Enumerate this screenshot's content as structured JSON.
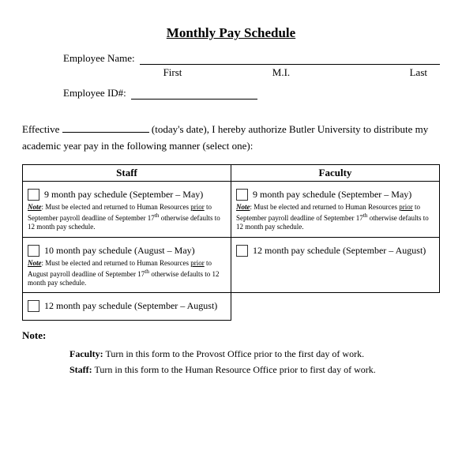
{
  "title": "Monthly Pay Schedule",
  "fields": {
    "name_label": "Employee  Name:",
    "first": "First",
    "mi": "M.I.",
    "last": "Last",
    "id_label": "Employee ID#:"
  },
  "paragraph": {
    "prefix": "Effective",
    "after_date": "(today's date), I hereby authorize Butler University to distribute my academic year pay in the following manner (select one):"
  },
  "table": {
    "headers": {
      "staff": "Staff",
      "faculty": "Faculty"
    },
    "staff": {
      "opt1": {
        "label": "9 month pay schedule (September – May)",
        "note_prefix": "Note",
        "note_body": ": Must be elected and returned to Human Resources ",
        "note_u": "prior",
        "note_tail": " to September payroll deadline of September 17",
        "note_end": " otherwise defaults to 12 month pay schedule."
      },
      "opt2": {
        "label": "10 month pay schedule (August – May)",
        "note_prefix": "Note",
        "note_body": ": Must be elected and returned to Human Resources ",
        "note_u": "prior",
        "note_tail": " to August payroll deadline of September 17",
        "note_end": " otherwise defaults to 12 month pay schedule."
      },
      "opt3": {
        "label": "12 month pay schedule (September – August)"
      }
    },
    "faculty": {
      "opt1": {
        "label": "9 month pay schedule (September – May)",
        "note_prefix": "Note",
        "note_body": ": Must be elected and returned to Human Resources ",
        "note_u": "prior",
        "note_tail": " to September payroll deadline of September 17",
        "note_end": " otherwise defaults to 12 month pay schedule."
      },
      "opt2": {
        "label": "12 month pay schedule (September – August)"
      }
    }
  },
  "notes": {
    "header": "Note:",
    "faculty_label": "Faculty:",
    "faculty_text": "  Turn in this form to the Provost Office prior to the first day of work.",
    "staff_label": "Staff:",
    "staff_text": " Turn in this form to the Human Resource Office prior to first day of work."
  }
}
